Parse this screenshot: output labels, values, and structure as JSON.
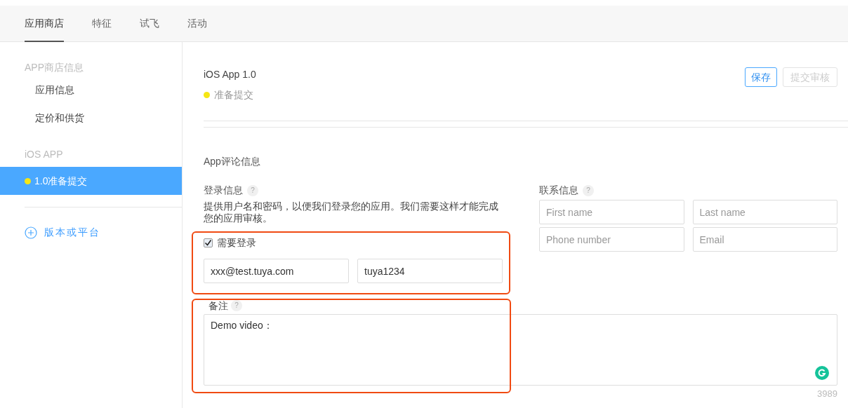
{
  "tabs": [
    {
      "label": "应用商店",
      "selected": true
    },
    {
      "label": "特征",
      "selected": false
    },
    {
      "label": "试飞",
      "selected": false
    },
    {
      "label": "活动",
      "selected": false
    }
  ],
  "sidebar": {
    "sections": [
      {
        "heading": "APP商店信息",
        "items": [
          {
            "label": "应用信息",
            "selected": false
          },
          {
            "label": "定价和供货",
            "selected": false
          }
        ]
      },
      {
        "heading": "iOS APP",
        "items": [
          {
            "label": "1.0准备提交",
            "selected": true,
            "color": "#f5e614"
          }
        ]
      }
    ],
    "add_link": "版本或平台"
  },
  "header": {
    "title": "iOS App 1.0",
    "status": {
      "label": "准备提交",
      "color": "#f5e614"
    },
    "buttons": [
      {
        "label": "保存",
        "disabled": false
      },
      {
        "label": "提交审核",
        "disabled": true
      }
    ]
  },
  "section_title": "App评论信息",
  "login": {
    "title": "登录信息",
    "help": "?",
    "description": "提供用户名和密码，以便我们登录您的应用。我们需要这样才能完成您的应用审核。",
    "highlighted": true,
    "required": {
      "label": "需要登录",
      "checked": true
    },
    "username": "xxx@test.tuya.com",
    "password": "tuya1234"
  },
  "contact": {
    "title": "联系信息",
    "help": "?",
    "fields": [
      {
        "placeholder": "First name"
      },
      {
        "placeholder": "Last name"
      },
      {
        "placeholder": "Phone number"
      },
      {
        "placeholder": "Email"
      }
    ]
  },
  "notes": {
    "title": "备注",
    "help": "?",
    "value": "Demo video：",
    "highlighted": true,
    "counter": "3989"
  }
}
